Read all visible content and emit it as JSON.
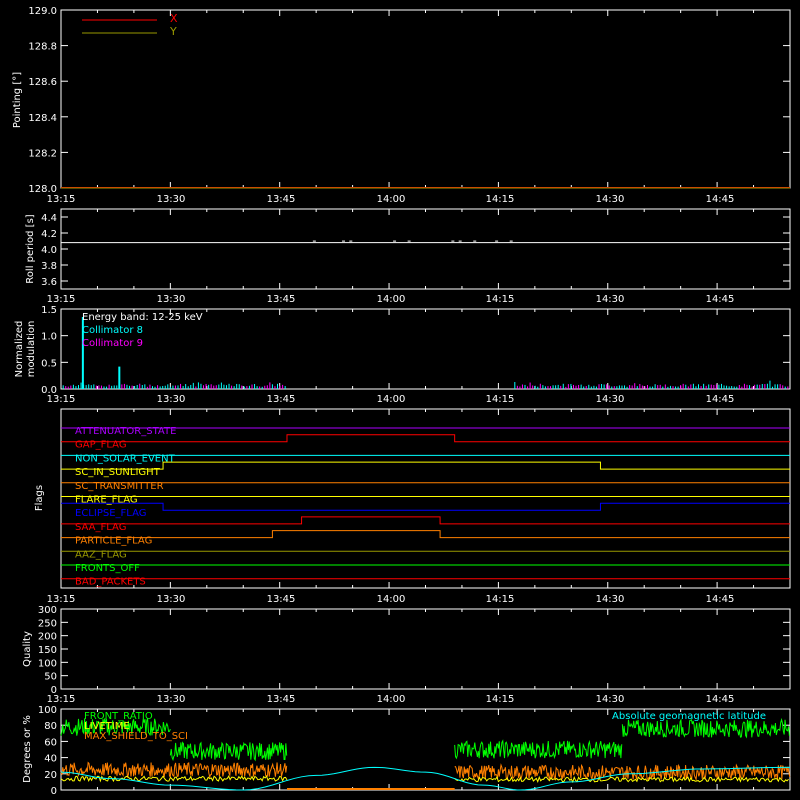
{
  "x_ticks": [
    "13:15",
    "13:30",
    "13:45",
    "14:00",
    "14:15",
    "14:30",
    "14:45"
  ],
  "x_tick_minutes": [
    0,
    15,
    30,
    45,
    60,
    75,
    90
  ],
  "x_range_minutes": [
    0,
    100
  ],
  "colors": {
    "background": "#000000",
    "axes": "#ffffff",
    "red": "#ff0000",
    "olive": "#999900",
    "cyan": "#00ffff",
    "magenta": "#ff00ff",
    "green": "#00ff00",
    "orange": "#ff8000",
    "yellow": "#ffff00",
    "blue": "#0000ff",
    "purple": "#aa00ff"
  },
  "chart_data": [
    {
      "type": "line",
      "name": "pointing",
      "ylabel": "Pointing [°]",
      "ylim": [
        128.0,
        129.0
      ],
      "y_ticks": [
        "128.0",
        "128.2",
        "128.4",
        "128.6",
        "128.8",
        "129.0"
      ],
      "legend": [
        "X",
        "Y"
      ],
      "legend_position": "top-left",
      "series": [
        {
          "name": "X",
          "color": "#ff0000",
          "x": [
            0,
            100
          ],
          "y": [
            128.0,
            128.0
          ]
        },
        {
          "name": "Y",
          "color": "#999900",
          "x": [
            0,
            100
          ],
          "y": [
            128.0,
            128.0
          ]
        }
      ]
    },
    {
      "type": "line",
      "name": "roll-period",
      "ylabel": "Roll period [s]",
      "ylim": [
        3.5,
        4.5
      ],
      "y_ticks": [
        "3.6",
        "3.8",
        "4.0",
        "4.2",
        "4.4"
      ],
      "series": [
        {
          "name": "",
          "color": "#ffffff",
          "x": [
            0,
            100
          ],
          "y": [
            4.08,
            4.08
          ]
        }
      ]
    },
    {
      "type": "line",
      "name": "modulation",
      "ylabel": [
        "Normalized",
        "modulation"
      ],
      "ylim": [
        0,
        1.5
      ],
      "y_ticks": [
        "0.0",
        "0.5",
        "1.0",
        "1.5"
      ],
      "annotations": [
        "Energy band: 12-25 keV",
        "Collimator 8",
        "Collimator 9"
      ],
      "data_gap_minutes": [
        31,
        62
      ],
      "spikes": [
        {
          "x": 3,
          "y": 1.35,
          "color": "#00ffff"
        },
        {
          "x": 8,
          "y": 0.42,
          "color": "#00ffff"
        }
      ],
      "baseline": 0.07
    },
    {
      "type": "timeline",
      "name": "flags",
      "ylabel": "Flags",
      "flags": [
        {
          "label": "ATTENUATOR_STATE",
          "color": "#aa00ff",
          "high": []
        },
        {
          "label": "GAP_FLAG",
          "color": "#ff0000",
          "high": [
            [
              31,
              54
            ]
          ]
        },
        {
          "label": "NON_SOLAR_EVENT",
          "color": "#00ffff",
          "high": []
        },
        {
          "label": "SC_IN_SUNLIGHT",
          "color": "#ffff00",
          "high": [
            [
              14,
              74
            ]
          ]
        },
        {
          "label": "SC_TRANSMITTER",
          "color": "#ff8000",
          "high": []
        },
        {
          "label": "FLARE_FLAG",
          "color": "#ffff00",
          "high": []
        },
        {
          "label": "ECLIPSE_FLAG",
          "color": "#0000ff",
          "high": [
            [
              0,
              14
            ],
            [
              74,
              100
            ]
          ]
        },
        {
          "label": "SAA_FLAG",
          "color": "#ff0000",
          "high": [
            [
              33,
              52
            ]
          ]
        },
        {
          "label": "PARTICLE_FLAG",
          "color": "#ff8000",
          "high": [
            [
              29,
              52
            ]
          ]
        },
        {
          "label": "AAZ_FLAG",
          "color": "#999900",
          "high": []
        },
        {
          "label": "FRONTS_OFF",
          "color": "#00ff00",
          "high": []
        },
        {
          "label": "BAD_PACKETS",
          "color": "#ff0000",
          "high": []
        }
      ]
    },
    {
      "type": "line",
      "name": "quality",
      "ylabel": "Quality",
      "ylim": [
        0,
        300
      ],
      "y_ticks": [
        "0",
        "50",
        "100",
        "150",
        "200",
        "250",
        "300"
      ],
      "series": []
    },
    {
      "type": "line",
      "name": "housekeeping",
      "ylabel": "Degrees or %",
      "ylim": [
        0,
        100
      ],
      "y_ticks": [
        "0",
        "20",
        "40",
        "60",
        "80",
        "100"
      ],
      "legend": [
        "FRONT_RATIO",
        "LIVETIME",
        "MAX_SHIELD_TO_SCI",
        "Absolute geomagnetic latitude"
      ],
      "data_gap_minutes": [
        31,
        54
      ],
      "series": [
        {
          "name": "FRONT_RATIO",
          "color": "#00ff00",
          "segments": [
            [
              0,
              15,
              78
            ],
            [
              15,
              31,
              48
            ],
            [
              54,
              77,
              50
            ],
            [
              77,
              100,
              76
            ]
          ]
        },
        {
          "name": "MAX_SHIELD_TO_SCI",
          "color": "#ff8000",
          "segments": [
            [
              0,
              31,
              25
            ],
            [
              54,
              100,
              22
            ]
          ]
        },
        {
          "name": "LIVETIME",
          "color": "#ffff00",
          "segments": [
            [
              0,
              31,
              14
            ],
            [
              54,
              100,
              13
            ]
          ]
        },
        {
          "name": "Absolute geomagnetic latitude",
          "color": "#00ffff",
          "x": [
            0,
            7,
            15,
            25,
            35,
            43,
            50,
            58,
            63,
            70,
            78,
            88,
            100
          ],
          "y": [
            22,
            14,
            6,
            0,
            18,
            28,
            22,
            6,
            0,
            10,
            20,
            26,
            28
          ]
        }
      ]
    }
  ]
}
